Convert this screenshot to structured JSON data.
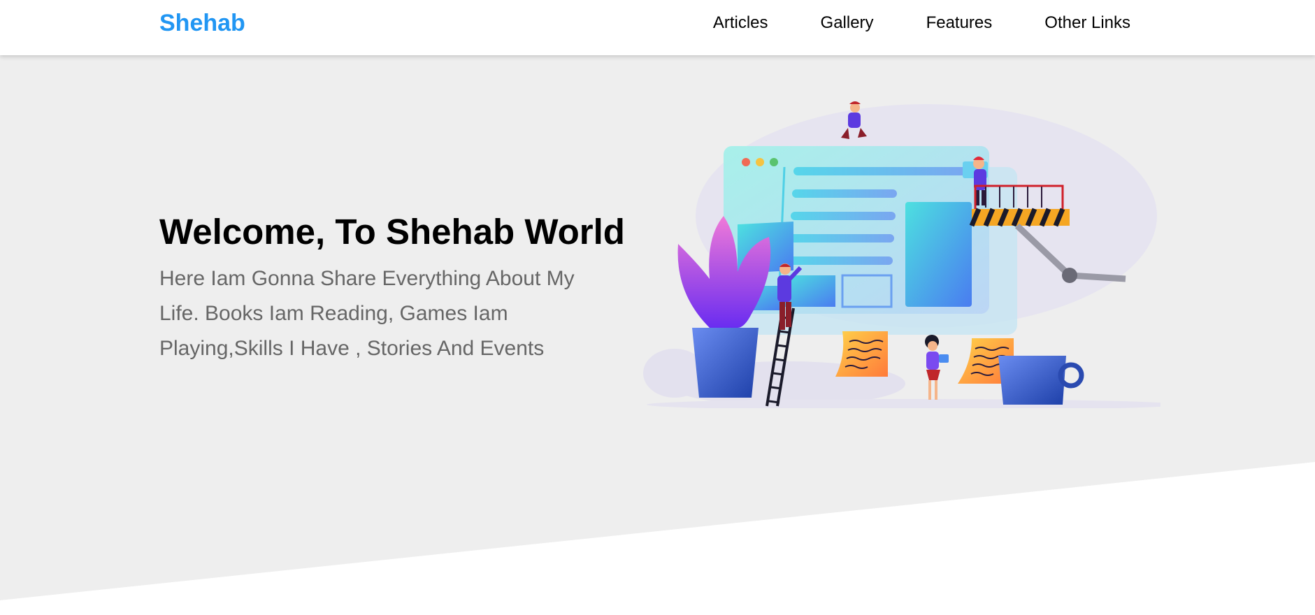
{
  "header": {
    "logo": "Shehab",
    "nav": [
      {
        "label": "Articles"
      },
      {
        "label": "Gallery"
      },
      {
        "label": "Features"
      },
      {
        "label": "Other Links"
      }
    ]
  },
  "hero": {
    "title": "Welcome, To Shehab World",
    "description": "Here Iam Gonna Share Everything About My Life. Books Iam Reading, Games Iam Playing,Skills I Have , Stories And Events",
    "illustration_icon": "web-design-team-illustration"
  },
  "go_down": {
    "icon": "double-chevron-down-icon"
  },
  "colors": {
    "brand": "#2196f3",
    "hero_bg": "#eeeeee",
    "text_muted": "#666666"
  }
}
